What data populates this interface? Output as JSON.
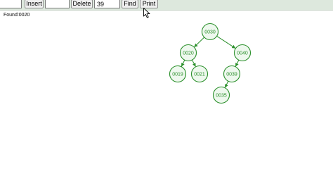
{
  "toolbar": {
    "insert_value": "",
    "insert_label": "Insert",
    "delete_value": "",
    "delete_label": "Delete",
    "find_value": "39",
    "find_label": "Find",
    "print_label": "Print"
  },
  "status": {
    "message": "Found:0020"
  },
  "tree": {
    "node_color": "#2a8f2a",
    "node_fill": "#eef8ee",
    "nodes": [
      {
        "id": "n0030",
        "label": "0030"
      },
      {
        "id": "n0020",
        "label": "0020"
      },
      {
        "id": "n0040",
        "label": "0040"
      },
      {
        "id": "n0019",
        "label": "0019"
      },
      {
        "id": "n0021",
        "label": "0021"
      },
      {
        "id": "n0039",
        "label": "0039"
      },
      {
        "id": "n0035",
        "label": "0035"
      }
    ],
    "edges": [
      {
        "from": "n0030",
        "to": "n0020"
      },
      {
        "from": "n0030",
        "to": "n0040"
      },
      {
        "from": "n0020",
        "to": "n0019"
      },
      {
        "from": "n0020",
        "to": "n0021"
      },
      {
        "from": "n0040",
        "to": "n0039"
      },
      {
        "from": "n0039",
        "to": "n0035"
      }
    ]
  }
}
